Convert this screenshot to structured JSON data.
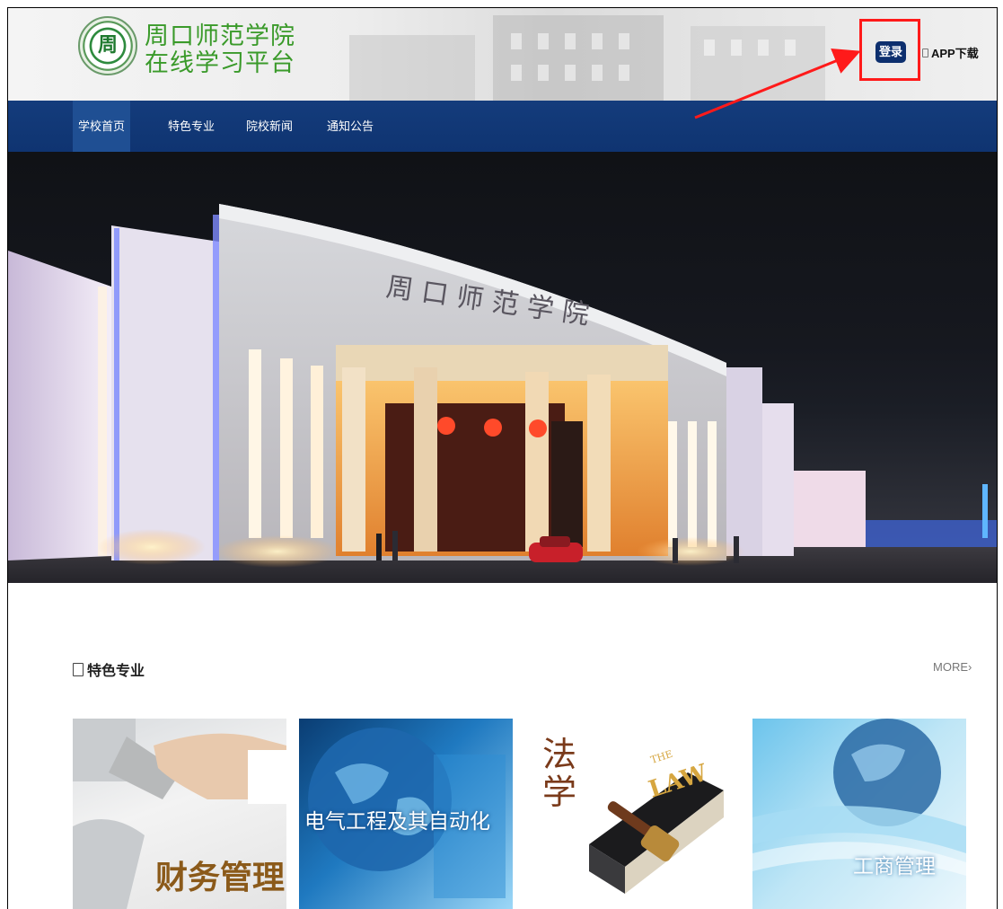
{
  "header": {
    "site_title_line1": "周口师范学院",
    "site_title_line2": "在线学习平台",
    "login_label": "登录",
    "app_download_label": "APP下载",
    "logo_char": "周"
  },
  "nav": {
    "items": [
      {
        "label": "学校首页",
        "active": true
      },
      {
        "label": "特色专业",
        "active": false
      },
      {
        "label": "院校新闻",
        "active": false
      },
      {
        "label": "通知公告",
        "active": false
      }
    ]
  },
  "banner": {
    "gate_inscription": "周 口 师 范 学 院"
  },
  "featured": {
    "title": "特色专业",
    "more_label": "MORE›",
    "cards": [
      {
        "label": "财务管理"
      },
      {
        "label": "电气工程及其自动化"
      },
      {
        "label": "法学",
        "book_text": "LAW",
        "book_small": "THE"
      },
      {
        "label": "工商管理"
      }
    ]
  },
  "colors": {
    "nav_bg": "#0f3471",
    "nav_active": "#1f4f93",
    "login_bg": "#0d2f6e",
    "highlight": "#ff1a1a",
    "title_green": "#3a9a2a"
  }
}
